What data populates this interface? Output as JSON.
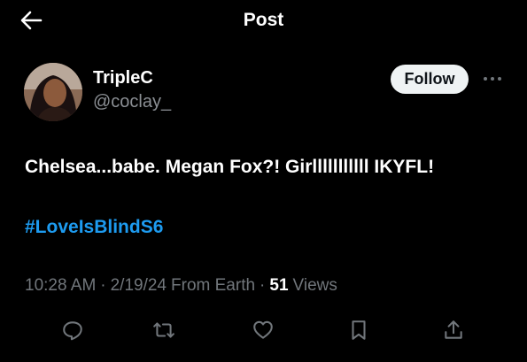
{
  "header": {
    "title": "Post",
    "back_icon": "arrow-left-icon"
  },
  "author": {
    "display_name": "TripleC",
    "handle": "@coclay_",
    "avatar_icon": "profile-photo"
  },
  "follow_label": "Follow",
  "more_icon": "ellipsis-icon",
  "post": {
    "text": "Chelsea...babe. Megan Fox?! Girlllllllllll IKYFL!",
    "hashtag": "#LoveIsBlindS6"
  },
  "meta": {
    "time": "10:28 AM",
    "separator": "·",
    "date": "2/19/24",
    "source": "From Earth",
    "view_count": "51",
    "views_label": "Views"
  },
  "actions": [
    {
      "name": "reply-icon"
    },
    {
      "name": "repost-icon"
    },
    {
      "name": "like-icon"
    },
    {
      "name": "bookmark-icon"
    },
    {
      "name": "share-icon"
    }
  ],
  "colors": {
    "background": "#000000",
    "text": "#ffffff",
    "muted": "#71767b",
    "link": "#1d9bf0",
    "follow_bg": "#eff3f4"
  }
}
